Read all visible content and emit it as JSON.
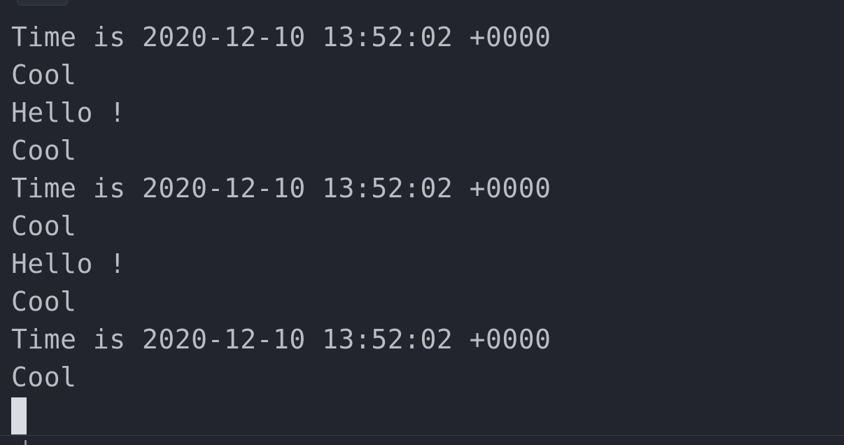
{
  "terminal": {
    "lines": [
      "Time is 2020-12-10 13:52:02 +0000",
      "Cool",
      "Hello !",
      "Cool",
      "Time is 2020-12-10 13:52:02 +0000",
      "Cool",
      "Hello !",
      "Cool",
      "Time is 2020-12-10 13:52:02 +0000",
      "Cool"
    ]
  },
  "colors": {
    "background": "#22252b",
    "text": "#b7bcc6",
    "cursor": "#d9dce1"
  }
}
